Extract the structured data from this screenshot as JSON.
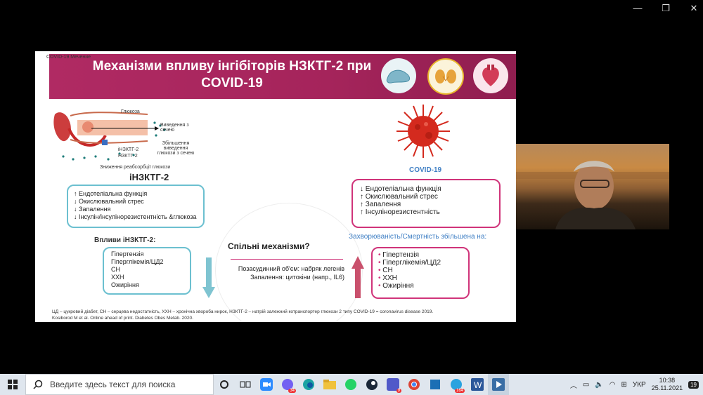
{
  "window_controls": {
    "minimize": "—",
    "restore": "❐",
    "close": "✕"
  },
  "slide": {
    "corner_label": "COVID-19 Мечение",
    "title_line1": "Механізми впливу інгібіторів НЗКТГ-2  при",
    "title_line2": "COVID-19",
    "kidney": {
      "glucose_label": "Глюкоза",
      "excretion_label": "Виведення з сечею",
      "increased_label": "Збільшення виведення глюкози з сечею",
      "inhibitor_label": "іНЗКТГ-2",
      "transporter_label": "НЗКТГ-2",
      "reabsorption_label": "Зниження реабсорбції глюкози",
      "heading": "іНЗКТГ-2"
    },
    "left_box": {
      "items": [
        {
          "arrow": "↑",
          "text": "Ендотеліальна функція"
        },
        {
          "arrow": "↓",
          "text": "Окислювальний стрес"
        },
        {
          "arrow": "↓",
          "text": "Запалення"
        },
        {
          "arrow": "↓",
          "text": "Інсулін/інсулінорезистентність &глюкоза"
        }
      ]
    },
    "effects_heading": "Впливи іНЗКТГ-2:",
    "effects_box": {
      "items": [
        "Гіпертензія",
        "Гіперглікемія/ЦД2",
        "СН",
        "ХХН",
        "Ожиріння"
      ]
    },
    "center": {
      "heading": "Спільні механізми?",
      "line1": "Позасудинний об'єм: набряк легенів",
      "line2": "Запалення: цитокіни (напр., IL6)"
    },
    "covid": {
      "label": "COVID-19"
    },
    "right_box": {
      "items": [
        {
          "arrow": "↓",
          "text": "Ендотеліальна функція"
        },
        {
          "arrow": "↑",
          "text": "Окислювальний стрес"
        },
        {
          "arrow": "↑",
          "text": "Запалення"
        },
        {
          "arrow": "↑",
          "text": "Інсулінорезистентність"
        }
      ]
    },
    "morbidity_heading": "Захворюваність/Смертність збільшена на:",
    "morbidity_box": {
      "items": [
        "Гіпертензія",
        "Гіперглікемія/ЦД2",
        "СН",
        "ХХН",
        "Ожиріння"
      ],
      "bullet": "•"
    },
    "footnote_line1": "ЦД – цукровий діабет, СН – серцева недостатність, ХХН – хронічна хвороба нирок, НЗКТГ-2 – натрій залежний котранспортер глюкози 2 типу COVID-19 = coronavirus disease 2019.",
    "footnote_line2": "Kosiborod M et al. Online ahead of print. Diabetes Obes Metab. 2020."
  },
  "colors": {
    "banner": "#b02a63",
    "teal": "#6cc0d0",
    "pink": "#d0347a",
    "covid_red": "#d42a1e"
  },
  "taskbar": {
    "search_placeholder": "Введите здесь текст для поиска",
    "badges": {
      "viber": "34",
      "teams": "9",
      "telegram": "164"
    },
    "lang": "УКР",
    "time": "10:38",
    "date": "25.11.2021",
    "notif_count": "19"
  }
}
